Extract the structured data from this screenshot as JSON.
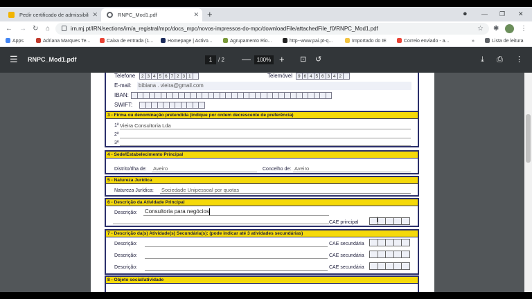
{
  "browser": {
    "tabs": [
      {
        "label": "Pedir certificado de admissibilida",
        "close": "✕"
      },
      {
        "label": "RNPC_Mod1.pdf",
        "close": "✕"
      }
    ],
    "new_tab": "+",
    "url": "irn.mj.pt/IRN/sections/irn/a_registral/mpc/docs_mpc/novos-impressos-do-mpc/downloadFile/attachedFile_f0/RNPC_Mod1.pdf",
    "back": "←",
    "forward": "→",
    "reload": "↻",
    "home": "⌂",
    "star": "☆",
    "puzzle": "✱",
    "kebab": "⋮",
    "win_min": "—",
    "win_max": "❐",
    "win_close": "✕",
    "profile": "●",
    "bookmarks": [
      {
        "label": "Apps",
        "color": "#4285f4"
      },
      {
        "label": "Adriana Marques Te...",
        "color": "#c0392b"
      },
      {
        "label": "Caixa de entrada (1...",
        "color": "#ea4335"
      },
      {
        "label": "Homepage | Activo...",
        "color": "#1a2a5a"
      },
      {
        "label": "Agrupamento Rio...",
        "color": "#7a9a3a"
      },
      {
        "label": "http--www.pai.pt-q...",
        "color": "#222222"
      },
      {
        "label": "Importado do IE",
        "color": "#f4c542"
      },
      {
        "label": "Correio enviado - a...",
        "color": "#ea4335"
      }
    ],
    "bm_more": "»",
    "reading_list": "Lista de leitura"
  },
  "pdf": {
    "menu": "☰",
    "filename": "RNPC_Mod1.pdf",
    "page": "1",
    "page_total": "/ 2",
    "zoom_out": "—",
    "zoom": "100%",
    "zoom_in": "+",
    "fit": "⊡",
    "rotate": "↺",
    "download": "⤓",
    "print": "⎙",
    "more": "⋮"
  },
  "form": {
    "contact": {
      "telefone_label": "Telefone",
      "telefone_digits": [
        "2",
        "3",
        "4",
        "5",
        "6",
        "7",
        "2",
        "3",
        "1",
        ""
      ],
      "telemovel_label": "Telemóvel",
      "telemovel_digits": [
        "9",
        "6",
        "4",
        "5",
        "6",
        "3",
        "4",
        "2",
        ""
      ],
      "email_label": "E-mail:",
      "email_value": "bibiana . vieira@gmail.com",
      "iban_label": "IBAN:",
      "swift_label": "SWIFT:"
    },
    "s3": {
      "header": "3 - Firma ou denominação pretendida (indique por ordem decrescente de preferência)",
      "l1": "1ª",
      "v1": "Vieira Consultoria Lda",
      "l2": "2ª",
      "l3": "3ª"
    },
    "s4": {
      "header": "4 - Sede/Estabelecimento Principal",
      "distrito_label": "Distrito/Ilha de:",
      "distrito_value": "Aveiro",
      "concelho_label": "Concelho de:",
      "concelho_value": "Aveiro"
    },
    "s5": {
      "header": "5 - Natureza Jurídica",
      "label": "Natureza  Jurídica:",
      "value": "Sociedade Unipessoal por quotas"
    },
    "s6": {
      "header": "6 - Descrição da Atividade Principal",
      "desc_label": "Descrição:",
      "desc_value": "Consultoria para negócios",
      "cae_label": "CAE principal"
    },
    "s7": {
      "header": "7 - Descrição da(s) Atividade(s) Secundária(s): (pode indicar até 3 atividades secundárias)",
      "rows": [
        {
          "label": "Descrição:",
          "cae": "CAE secundária"
        },
        {
          "label": "Descrição:",
          "cae": "CAE secundária"
        },
        {
          "label": "Descrição:",
          "cae": "CAE secundária"
        }
      ]
    },
    "s8": {
      "header": "8 - Objeto social/atividade"
    }
  }
}
